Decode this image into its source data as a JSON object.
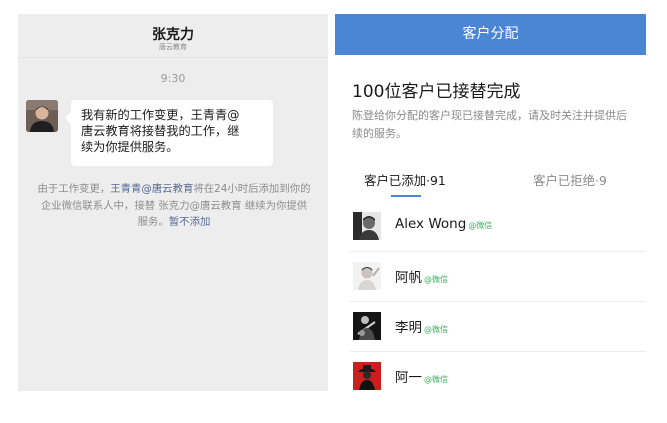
{
  "chat": {
    "header_title": "张克力",
    "header_subtitle": "唐云教育",
    "timestamp": "9:30",
    "message_lines": [
      "我有新的工作变更，王青青@",
      "唐云教育将接替我的工作，继",
      "续为你提供服务。"
    ],
    "system_note": {
      "part1": "由于工作变更，",
      "link1": "王青青@唐云教育",
      "part2": "将在24小时后添加到你的企业微信联系人中，接替 张克力@唐云教育 继续为你提供服务。",
      "link2": "暂不添加"
    }
  },
  "allocation": {
    "header_title": "客户分配",
    "result_title": "100位客户已接替完成",
    "result_desc": "陈登给你分配的客户现已接替完成，请及时关注并提供后续的服务。",
    "tabs": [
      {
        "label": "客户已添加·91",
        "active": true
      },
      {
        "label": "客户已拒绝·9",
        "active": false
      }
    ],
    "customers": [
      {
        "name": "Alex Wong",
        "tag": "@微信",
        "avatar_icon": "person-photo-bw"
      },
      {
        "name": "阿帆",
        "tag": "@微信",
        "avatar_icon": "person-photo-light"
      },
      {
        "name": "李明",
        "tag": "@微信",
        "avatar_icon": "person-photo-guitar"
      },
      {
        "name": "阿一",
        "tag": "@微信",
        "avatar_icon": "person-photo-red"
      }
    ]
  },
  "colors": {
    "accent": "#4a86d4",
    "link": "#576b95",
    "wechat_tag": "#3cb35b",
    "chat_bg": "#ededed"
  }
}
